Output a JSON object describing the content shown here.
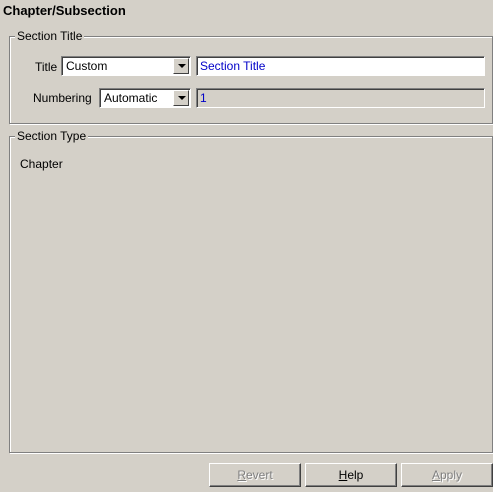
{
  "panel": {
    "title": "Chapter/Subsection"
  },
  "section_title_group": {
    "legend": "Section Title",
    "title_label": "Title",
    "title_select_value": "Custom",
    "title_text_value": "Section Title",
    "numbering_label": "Numbering",
    "numbering_select_value": "Automatic",
    "numbering_text_value": "1"
  },
  "section_type_group": {
    "legend": "Section Type",
    "value": "Chapter"
  },
  "footer": {
    "revert": {
      "accel": "R",
      "rest": "evert",
      "enabled": false
    },
    "help": {
      "accel": "H",
      "rest": "elp",
      "enabled": true
    },
    "apply": {
      "accel": "A",
      "rest": "pply",
      "enabled": false
    }
  }
}
